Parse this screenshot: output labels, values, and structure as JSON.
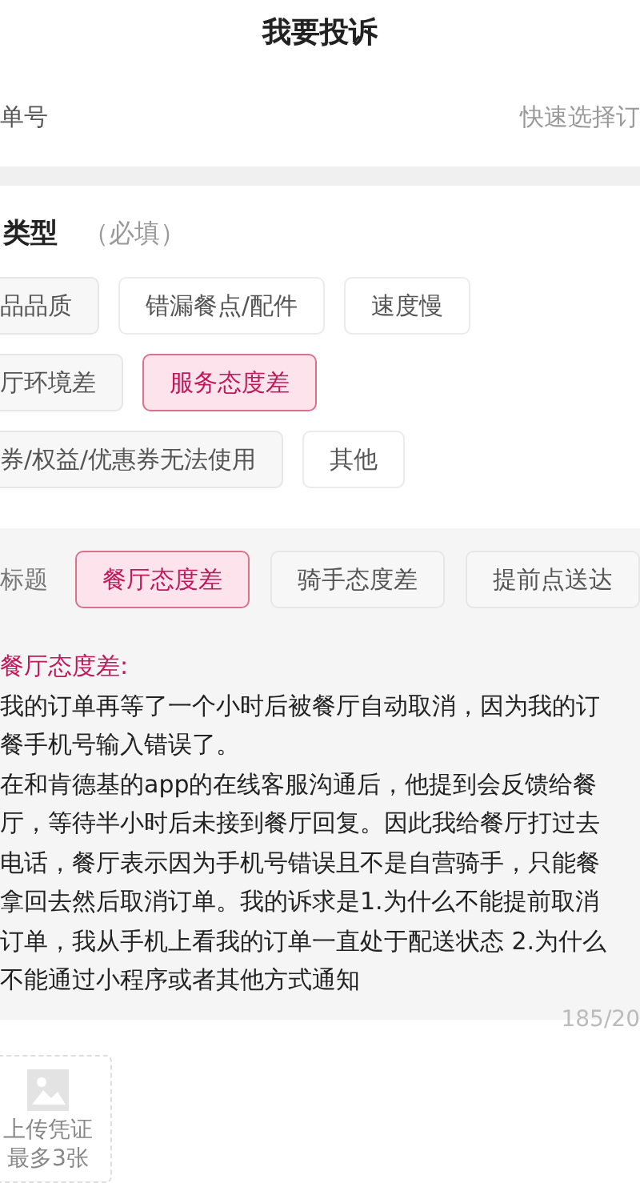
{
  "header": {
    "title": "我要投诉"
  },
  "order": {
    "label": "单号",
    "placeholder": "快速选择订"
  },
  "complaint_type": {
    "label": "类型",
    "hint": "（必填）",
    "options": [
      {
        "label": "品品质",
        "selected": false
      },
      {
        "label": "错漏餐点/配件",
        "selected": false
      },
      {
        "label": "速度慢",
        "selected": false
      },
      {
        "label": "厅环境差",
        "selected": false
      },
      {
        "label": "服务态度差",
        "selected": true
      },
      {
        "label": "券/权益/优惠券无法使用",
        "selected": false
      },
      {
        "label": "其他",
        "selected": false
      }
    ]
  },
  "title_picker": {
    "label": "标题",
    "options": [
      {
        "label": "餐厅态度差",
        "selected": true
      },
      {
        "label": "骑手态度差",
        "selected": false
      },
      {
        "label": "提前点送达",
        "selected": false
      }
    ]
  },
  "description": {
    "heading": "餐厅态度差:",
    "lines": [
      "我的订单再等了一个小时后被餐厅自动取消，因为我的订",
      "餐手机号输入错误了。",
      "在和肯德基的app的在线客服沟通后，他提到会反馈给餐",
      "厅，等待半小时后未接到餐厅回复。因此我给餐厅打过去",
      "电话，餐厅表示因为手机号错误且不是自营骑手，只能餐",
      "拿回去然后取消订单。我的诉求是1.为什么不能提前取消",
      "订单，我从手机上看我的订单一直处于配送状态 2.为什么",
      "不能通过小程序或者其他方式通知"
    ],
    "counter": "185/20"
  },
  "upload": {
    "label": "上传凭证",
    "limit": "最多3张"
  }
}
